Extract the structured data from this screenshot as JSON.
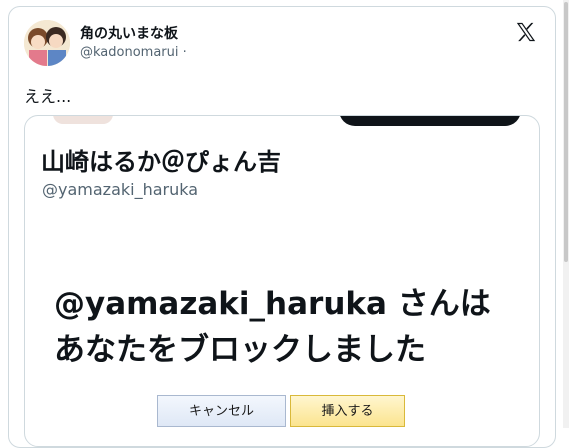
{
  "tweet": {
    "display_name": "角の丸いまな板",
    "handle": "@kadonomarui ·",
    "text": "ええ..."
  },
  "embedded_screenshot": {
    "name": "山崎はるか＠ぴょん吉",
    "handle": "@yamazaki_haruka",
    "message": "@yamazaki_haruka さんはあなたをブロックしました"
  },
  "popup": {
    "cancel_label": "キャンセル",
    "insert_label": "挿入する"
  },
  "icons": {
    "brand": "x-logo-icon",
    "avatar": "anime-avatar"
  },
  "colors": {
    "text": "#0f1419",
    "secondary": "#536471",
    "border": "#cfd9de",
    "insert_button": "#fbe48f",
    "cancel_button": "#dfe8f6"
  }
}
